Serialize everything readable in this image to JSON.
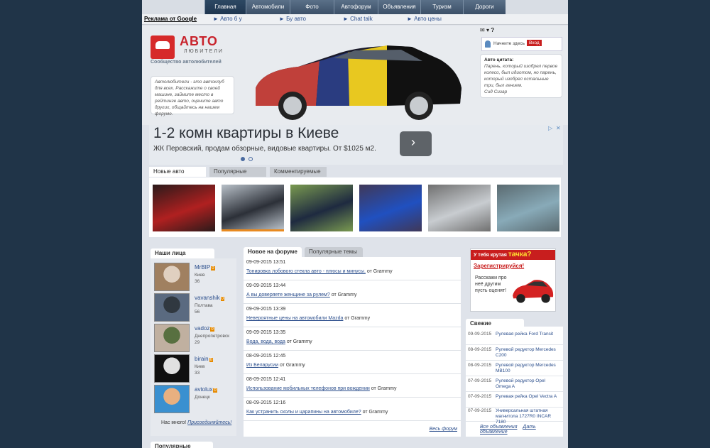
{
  "nav": {
    "tabs": [
      "Главная",
      "Автомобили",
      "Фото",
      "Автофорум",
      "Объявления",
      "Туризм",
      "Дороги"
    ],
    "active": 0
  },
  "links": {
    "google": "Реклама от Google",
    "items": [
      "Авто б у",
      "Бу авто",
      "Chat talk",
      "Авто цены"
    ]
  },
  "header": {
    "logo_word": "АВТО",
    "logo_sub": "ЛЮБИТЕЛИ",
    "logo_badge": "avtolubiteli",
    "tagline": "Сообщество автолюбителей",
    "intro": "Автолюбители - это автоклуб для всех. Расскажите о своей машине, займите место в рейтинге авто, оцените авто других, общайтесь на нашем форуме.",
    "login_text": "Начните здесь",
    "login_button": "Вход",
    "quote_title": "Авто цитата:",
    "quote_text": "Парень, который изобрел первое колесо, был идиотом, но парень, который изобрел остальные три, был гением.",
    "quote_author": "Сид Сизар"
  },
  "ad": {
    "title": "1-2 комн квартиры в Киеве",
    "desc": "ЖК Перовский, продам обзорные, видовые квартиры. От $1025 м2."
  },
  "gallery": {
    "tabs": [
      "Новые авто",
      "Популярные",
      "Комментируемые"
    ],
    "thumbs": [
      {
        "name": "red-car-photo",
        "c1": "#b02020",
        "c2": "#2a1a1a"
      },
      {
        "name": "black-car-photo",
        "c1": "#2c3038",
        "c2": "#b8c0c8"
      },
      {
        "name": "dark-suv-photo",
        "c1": "#1e2a40",
        "c2": "#7a9a50"
      },
      {
        "name": "blue-car-photo",
        "c1": "#2050c0",
        "c2": "#403858"
      },
      {
        "name": "silver-car-photo",
        "c1": "#c8ccd0",
        "c2": "#707070"
      },
      {
        "name": "damaged-car-photo",
        "c1": "#88aab8",
        "c2": "#5a6a70"
      }
    ]
  },
  "faces": {
    "title": "Наши лица",
    "items": [
      {
        "name": "MrBIP",
        "badge": "0",
        "city": "Киев",
        "age": "36",
        "c1": "#a08060",
        "c2": "#e0d0c0"
      },
      {
        "name": "vavanshik",
        "badge": "0",
        "city": "Полтава",
        "age": "56",
        "c1": "#5a6a80",
        "c2": "#303840"
      },
      {
        "name": "vadoz",
        "badge": "0",
        "city": "Днепропетровск",
        "age": "29",
        "c1": "#c0b0a0",
        "c2": "#587040"
      },
      {
        "name": "birain",
        "badge": "0",
        "city": "Киев",
        "age": "33",
        "c1": "#101010",
        "c2": "#e0e0e0"
      },
      {
        "name": "avtolux",
        "badge": "0",
        "city": "Донецк",
        "age": "",
        "c1": "#3a90d0",
        "c2": "#e8b080"
      }
    ],
    "footer_prefix": "Нас много!",
    "footer_link": "Присоединяйтесь!"
  },
  "forum": {
    "tabs": [
      "Новое на форуме",
      "Популярные темы"
    ],
    "posts": [
      {
        "date": "09-09-2015 13:51",
        "title": "Тонировка лобового стекла авто - плюсы и минусы.",
        "author": "от Grammy"
      },
      {
        "date": "09-09-2015 13:44",
        "title": "А вы доверяете женщине за рулем?",
        "author": "от Grammy"
      },
      {
        "date": "09-09-2015 13:39",
        "title": "Невероятные цены на автомобили Mazda",
        "author": "от Grammy"
      },
      {
        "date": "09-09-2015 13:35",
        "title": "Вода, вода, вода",
        "author": "от Grammy"
      },
      {
        "date": "08-09-2015 12:45",
        "title": "Из Беларусии",
        "author": "от Grammy"
      },
      {
        "date": "08-09-2015 12:41",
        "title": "Использование мобильных телефонов при вождении",
        "author": "от Grammy"
      },
      {
        "date": "08-09-2015 12:16",
        "title": "Как устранить сколы и царапины на автомобиле?",
        "author": "от Grammy"
      }
    ],
    "all_link": "Весь форум"
  },
  "promo": {
    "title": "У тебя крутая",
    "title_word": "тачка?",
    "register": "Зарегистрируйся!",
    "text": "Расскажи про неё другим пусть оценят!"
  },
  "ads": {
    "title": "Свежие объявления",
    "rows": [
      {
        "date": "09-09-2015",
        "text": "Рулевая рейка Ford Transit"
      },
      {
        "date": "08-09-2015",
        "text": "Рулевой редуктор Mercedes C200"
      },
      {
        "date": "08-09-2015",
        "text": "Рулевой редуктор Mercedes MB100"
      },
      {
        "date": "07-09-2015",
        "text": "Рулевой редуктор Opel Omega A"
      },
      {
        "date": "07-09-2015",
        "text": "Рулевая рейка Opel Vectra A"
      },
      {
        "date": "07-09-2015",
        "text": "Универсальная штатная магнитола 1727R0 INCAR 7180"
      }
    ],
    "all": "Все объявления",
    "post": "Дать объявление"
  },
  "popular_forums": "Популярные форумы"
}
